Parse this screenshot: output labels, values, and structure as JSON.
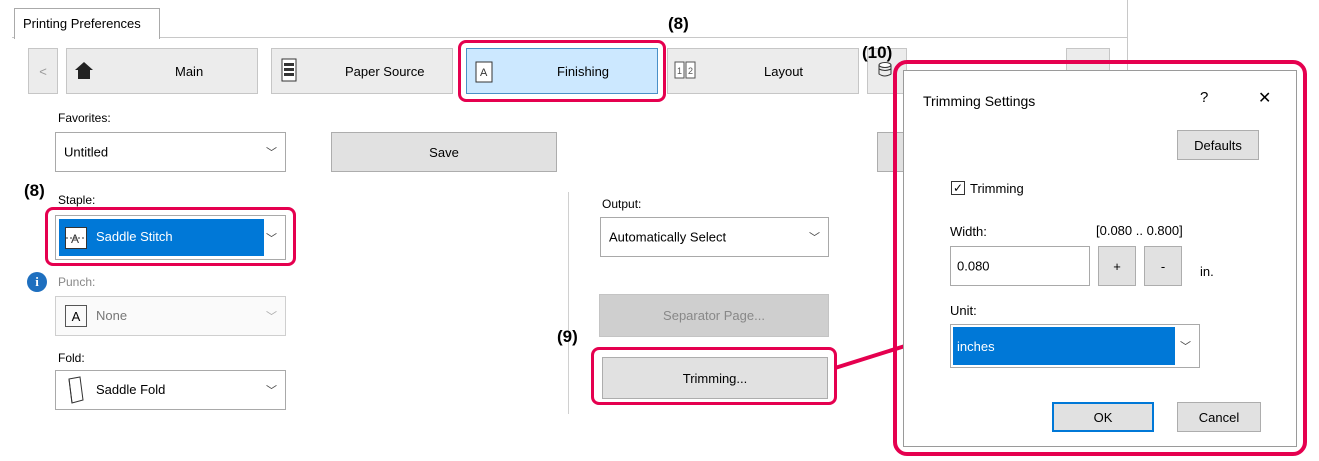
{
  "window": {
    "tab_label": "Printing Preferences"
  },
  "nav": {
    "prev_label": "<",
    "main_label": "Main",
    "paper_source_label": "Paper Source",
    "finishing_label": "Finishing",
    "layout_label": "Layout"
  },
  "favorites": {
    "label": "Favorites:",
    "value": "Untitled",
    "save_label": "Save"
  },
  "staple": {
    "label": "Staple:",
    "value": "Saddle Stitch"
  },
  "punch": {
    "label": "Punch:",
    "value": "None"
  },
  "fold": {
    "label": "Fold:",
    "value": "Saddle Fold"
  },
  "output": {
    "label": "Output:",
    "value": "Automatically Select"
  },
  "separator_label": "Separator Page...",
  "trimming_button_label": "Trimming...",
  "callouts": {
    "c8_top": "(8)",
    "c8_left": "(8)",
    "c9": "(9)",
    "c10": "(10)"
  },
  "dialog": {
    "title": "Trimming Settings",
    "help": "?",
    "close": "✕",
    "defaults_label": "Defaults",
    "trimming_checkbox_label": "Trimming",
    "trimming_checked": true,
    "width_label": "Width:",
    "width_range": "[0.080 .. 0.800]",
    "width_value": "0.080",
    "plus": "+",
    "minus": "-",
    "unit_suffix": "in.",
    "unit_label": "Unit:",
    "unit_value": "inches",
    "ok_label": "OK",
    "cancel_label": "Cancel"
  },
  "colors": {
    "highlight": "#e5004f",
    "selected": "#0078d7",
    "finishing_bg": "#cce8ff"
  }
}
